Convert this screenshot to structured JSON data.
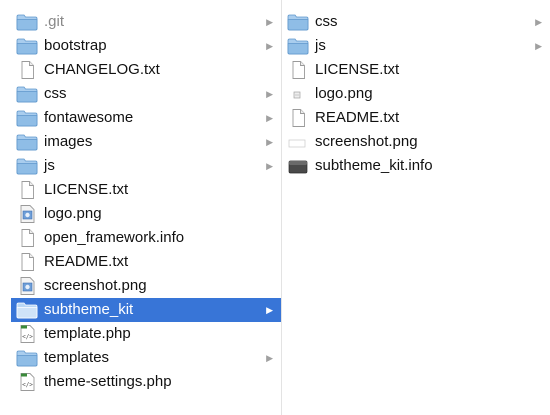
{
  "column1": {
    "items": [
      {
        "label": ".git",
        "type": "folder",
        "icon": "folder-icon",
        "has_children": true,
        "selected": false,
        "dim": true
      },
      {
        "label": "bootstrap",
        "type": "folder",
        "icon": "folder-icon",
        "has_children": true,
        "selected": false,
        "dim": false
      },
      {
        "label": "CHANGELOG.txt",
        "type": "file",
        "icon": "document-icon",
        "has_children": false,
        "selected": false,
        "dim": false
      },
      {
        "label": "css",
        "type": "folder",
        "icon": "folder-icon",
        "has_children": true,
        "selected": false,
        "dim": false
      },
      {
        "label": "fontawesome",
        "type": "folder",
        "icon": "folder-icon",
        "has_children": true,
        "selected": false,
        "dim": false
      },
      {
        "label": "images",
        "type": "folder",
        "icon": "folder-icon",
        "has_children": true,
        "selected": false,
        "dim": false
      },
      {
        "label": "js",
        "type": "folder",
        "icon": "folder-icon",
        "has_children": true,
        "selected": false,
        "dim": false
      },
      {
        "label": "LICENSE.txt",
        "type": "file",
        "icon": "document-icon",
        "has_children": false,
        "selected": false,
        "dim": false
      },
      {
        "label": "logo.png",
        "type": "image",
        "icon": "image-file-icon",
        "has_children": false,
        "selected": false,
        "dim": false
      },
      {
        "label": "open_framework.info",
        "type": "file",
        "icon": "document-icon",
        "has_children": false,
        "selected": false,
        "dim": false
      },
      {
        "label": "README.txt",
        "type": "file",
        "icon": "document-icon",
        "has_children": false,
        "selected": false,
        "dim": false
      },
      {
        "label": "screenshot.png",
        "type": "image",
        "icon": "image-file-icon",
        "has_children": false,
        "selected": false,
        "dim": false
      },
      {
        "label": "subtheme_kit",
        "type": "folder",
        "icon": "folder-icon",
        "has_children": true,
        "selected": true,
        "dim": false
      },
      {
        "label": "template.php",
        "type": "php",
        "icon": "php-file-icon",
        "has_children": false,
        "selected": false,
        "dim": false
      },
      {
        "label": "templates",
        "type": "folder",
        "icon": "folder-icon",
        "has_children": true,
        "selected": false,
        "dim": false
      },
      {
        "label": "theme-settings.php",
        "type": "php",
        "icon": "php-file-icon",
        "has_children": false,
        "selected": false,
        "dim": false
      }
    ]
  },
  "column2": {
    "items": [
      {
        "label": "css",
        "type": "folder",
        "icon": "folder-icon",
        "has_children": true,
        "selected": false,
        "dim": false
      },
      {
        "label": "js",
        "type": "folder",
        "icon": "folder-icon",
        "has_children": true,
        "selected": false,
        "dim": false
      },
      {
        "label": "LICENSE.txt",
        "type": "file",
        "icon": "document-icon",
        "has_children": false,
        "selected": false,
        "dim": false
      },
      {
        "label": "logo.png",
        "type": "image-small",
        "icon": "image-file-icon",
        "has_children": false,
        "selected": false,
        "dim": false
      },
      {
        "label": "README.txt",
        "type": "file",
        "icon": "document-icon",
        "has_children": false,
        "selected": false,
        "dim": false
      },
      {
        "label": "screenshot.png",
        "type": "image-blank",
        "icon": "image-file-icon",
        "has_children": false,
        "selected": false,
        "dim": false
      },
      {
        "label": "subtheme_kit.info",
        "type": "info",
        "icon": "info-file-icon",
        "has_children": false,
        "selected": false,
        "dim": false
      }
    ]
  },
  "arrow_glyph": "▶",
  "colors": {
    "selection": "#3875d7",
    "folder": "#8fbde6",
    "arrow": "#a0a0a0"
  }
}
